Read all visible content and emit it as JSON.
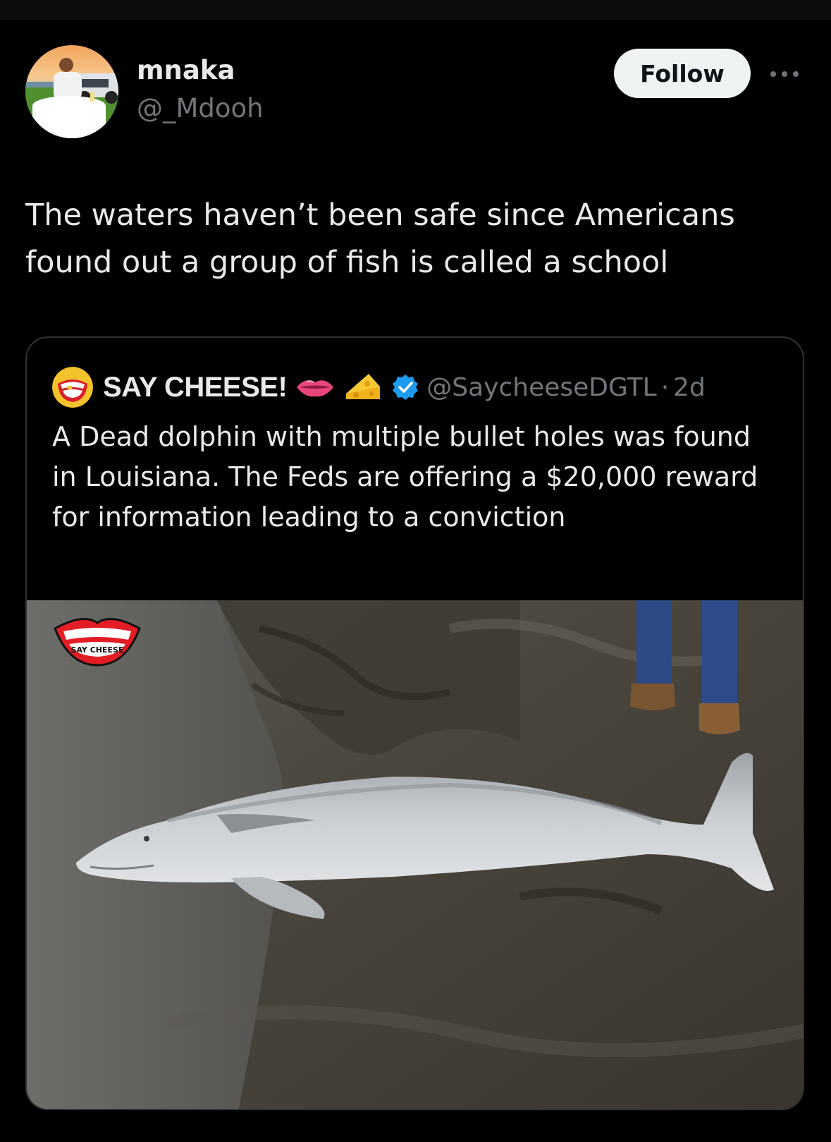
{
  "post": {
    "author_name": "mnaka",
    "author_handle": "@_Mdooh",
    "follow_label": "Follow",
    "text": "The waters haven’t been safe since Americans found out a group of fish is called a school"
  },
  "quoted_post": {
    "author_name": "SAY CHEESE!",
    "name_emojis": [
      "lips-emoji",
      "cheese-emoji"
    ],
    "verified": true,
    "author_handle": "@SaycheeseDGTL",
    "separator": "·",
    "time": "2d",
    "text": "A Dead dolphin with multiple bullet holes was found in Louisiana. The Feds are offering a $20,000 reward for information leading to a conviction",
    "media": {
      "kind": "photo",
      "watermark_text": "SAY CHEESE"
    }
  },
  "colors": {
    "background": "#000000",
    "text_primary": "#e7e9ea",
    "text_secondary": "#71767b",
    "border": "#2f3336",
    "follow_bg": "#eff3f4",
    "verified_blue": "#1d9bf0"
  },
  "icons": {
    "more": "more-horizontal-icon",
    "verified": "verified-badge-icon"
  }
}
